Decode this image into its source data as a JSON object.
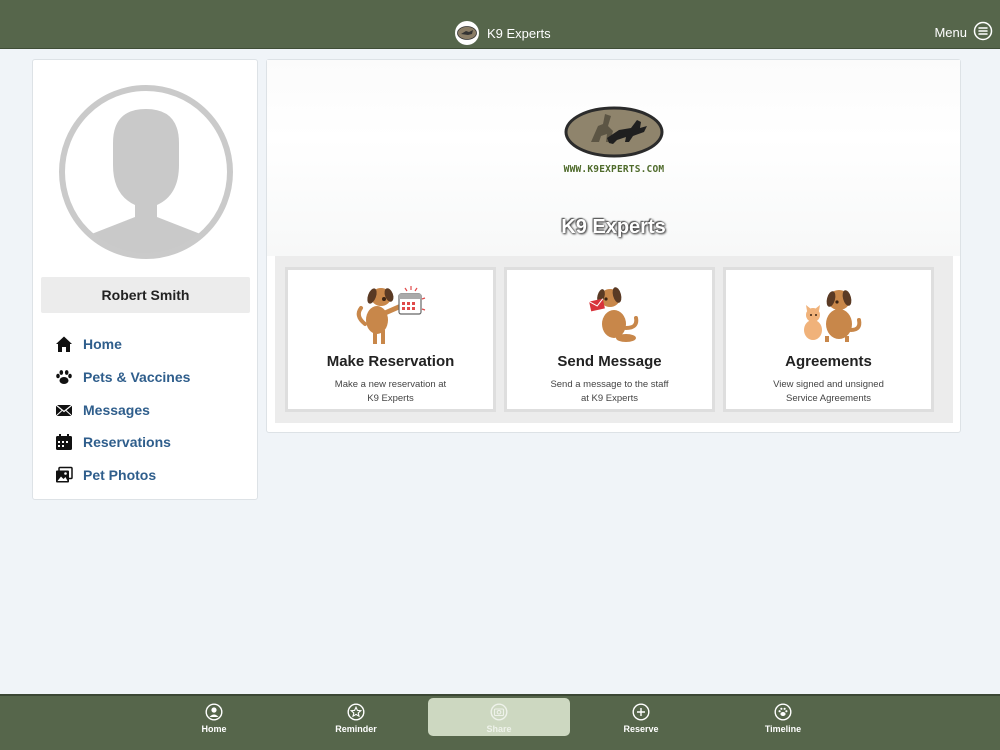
{
  "topbar": {
    "title": "K9 Experts",
    "menu_label": "Menu",
    "logo_icon": "k9-logo-icon",
    "menu_icon": "hamburger-circle-icon"
  },
  "profile": {
    "name": "Robert Smith",
    "avatar_icon": "user-avatar-icon"
  },
  "sidebar": {
    "items": [
      {
        "label": "Home",
        "icon": "home-icon"
      },
      {
        "label": "Pets & Vaccines",
        "icon": "paw-icon"
      },
      {
        "label": "Messages",
        "icon": "envelope-icon"
      },
      {
        "label": "Reservations",
        "icon": "calendar-icon"
      },
      {
        "label": "Pet Photos",
        "icon": "photos-icon"
      }
    ]
  },
  "hero": {
    "url_text": "WWW.K9EXPERTS.COM",
    "title": "K9 Experts"
  },
  "tiles": [
    {
      "title": "Make Reservation",
      "desc_line1": "Make a new reservation at",
      "desc_line2": "K9 Experts",
      "icon": "dog-calendar-icon"
    },
    {
      "title": "Send Message",
      "desc_line1": "Send a message to the staff",
      "desc_line2": "at K9 Experts",
      "icon": "dog-letter-icon"
    },
    {
      "title": "Agreements",
      "desc_line1": "View signed and unsigned",
      "desc_line2": "Service Agreements",
      "icon": "dog-cat-icon"
    }
  ],
  "bottom_tabs": [
    {
      "label": "Home",
      "icon": "home-circle-icon"
    },
    {
      "label": "Reminder",
      "icon": "star-icon"
    },
    {
      "label": "Share",
      "icon": "camera-icon",
      "active": true
    },
    {
      "label": "Reserve",
      "icon": "plus-circle-icon"
    },
    {
      "label": "Timeline",
      "icon": "paw-circle-icon"
    }
  ],
  "colors": {
    "bar_green": "#56664b",
    "link_blue": "#2f5e8c",
    "page_bg": "#f0f4f8"
  }
}
